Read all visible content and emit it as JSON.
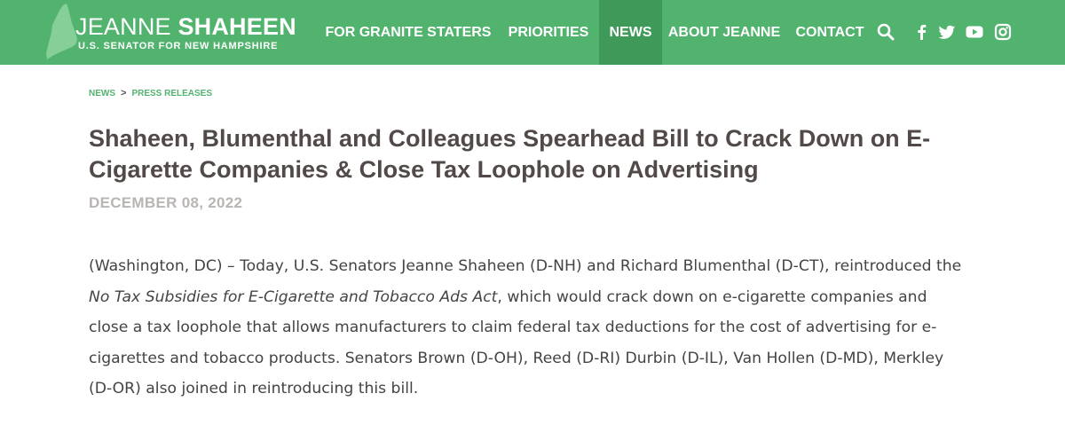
{
  "site": {
    "name_first": "JEANNE",
    "name_last": "SHAHEEN",
    "subtitle": "U.S. SENATOR FOR NEW HAMPSHIRE"
  },
  "nav": {
    "items": [
      {
        "label": "FOR GRANITE STATERS"
      },
      {
        "label": "PRIORITIES"
      },
      {
        "label": "NEWS"
      },
      {
        "label": "ABOUT JEANNE"
      },
      {
        "label": "CONTACT"
      }
    ],
    "active_index": 2,
    "icons": [
      "search-icon",
      "facebook-icon",
      "twitter-icon",
      "youtube-icon",
      "instagram-icon"
    ]
  },
  "breadcrumb": {
    "items": [
      "NEWS",
      "PRESS RELEASES"
    ],
    "separator": ">"
  },
  "article": {
    "title": "Shaheen, Blumenthal and Colleagues Spearhead Bill to Crack Down on E-Cigarette Companies & Close Tax Loophole on Advertising",
    "date": "DECEMBER 08, 2022",
    "body_part1": "(Washington, DC) – Today, U.S. Senators Jeanne Shaheen (D-NH) and Richard Blumenthal (D-CT), reintroduced the ",
    "body_italic": "No Tax Subsidies for E-Cigarette and Tobacco Ads Act",
    "body_part2": ", which would crack down on e-cigarette companies and close a tax loophole that allows manufacturers to claim federal tax deductions for the cost of advertising for e-cigarettes and tobacco products. Senators Brown (D-OH), Reed (D-RI) Durbin (D-IL), Van Hollen (D-MD), Merkley (D-OR) also joined in reintroducing this bill."
  },
  "colors": {
    "header_bg": "#52b36f",
    "nav_active_bg": "#3f9a5a",
    "breadcrumb": "#52b36f",
    "title": "#514a48",
    "date": "#b8b5b3",
    "body": "#444444"
  }
}
